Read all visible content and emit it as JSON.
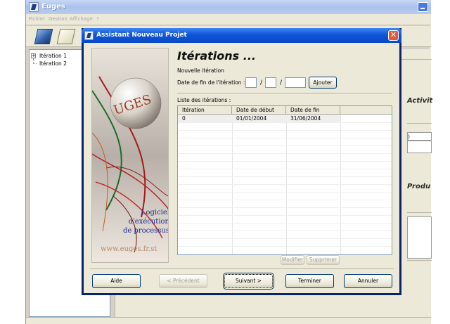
{
  "main_window": {
    "title": "Euges",
    "menu": [
      "Fichier",
      "Gestion",
      "Affichage",
      "?"
    ],
    "tree": {
      "items": [
        "Itération 1",
        "Itération 2"
      ]
    },
    "right_pane": {
      "label_activities": "Activit",
      "label_products": "Produ",
      "paren": ")"
    }
  },
  "dialog": {
    "title": "Assistant Nouveau Projet",
    "close_glyph": "✕",
    "banner": {
      "line1": "Logiciel",
      "line2": "d'exécution",
      "line3": "de processus",
      "url": "www.euges.fr.st",
      "sphere_text": "UGES"
    },
    "heading": "Itérations ...",
    "new_iteration_label": "Nouvelle itération",
    "end_date_label": "Date de fin de l'itération :",
    "date_slash": "/",
    "add_button": "Ajouter",
    "list_label": "Liste des itérations :",
    "list_columns": [
      "Itération",
      "Date de début",
      "Date de fin"
    ],
    "list_rows": [
      {
        "iteration": "0",
        "start": "01/01/2004",
        "end": "31/06/2004"
      }
    ],
    "modify_button": "Modifier",
    "delete_button": "Supprimer",
    "buttons": {
      "help": "Aide",
      "previous": "< Précédent",
      "next": "Suivant >",
      "finish": "Terminer",
      "cancel": "Annuler"
    }
  }
}
